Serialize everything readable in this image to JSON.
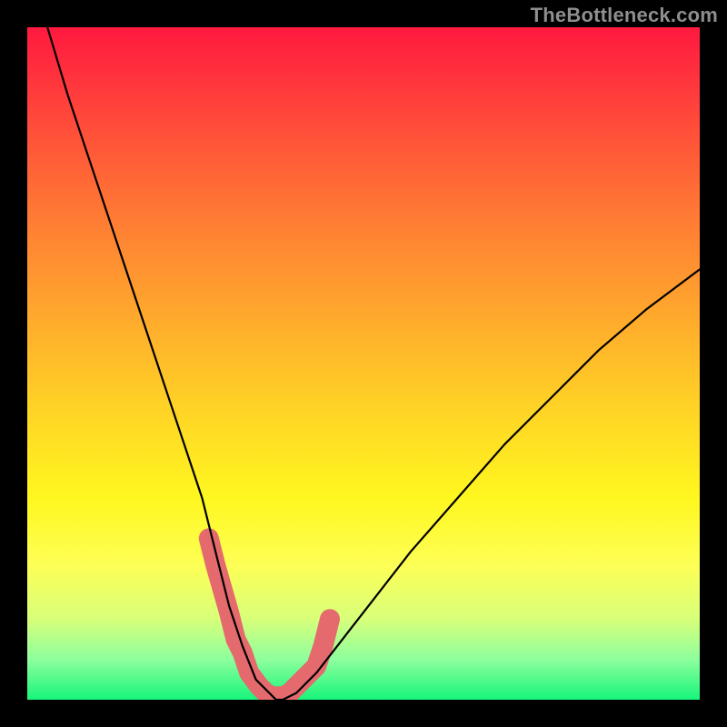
{
  "watermark": "TheBottleneck.com",
  "chart_data": {
    "type": "line",
    "title": "",
    "xlabel": "",
    "ylabel": "",
    "xlim": [
      0,
      100
    ],
    "ylim": [
      0,
      100
    ],
    "grid": false,
    "series": [
      {
        "name": "bottleneck-curve",
        "x": [
          3,
          6,
          10,
          14,
          18,
          22,
          26,
          28,
          30,
          32,
          34,
          36,
          37,
          38,
          40,
          43,
          50,
          57,
          64,
          71,
          78,
          85,
          92,
          100
        ],
        "values": [
          100,
          90,
          78,
          66,
          54,
          42,
          30,
          22,
          14,
          8,
          3,
          1,
          0,
          0,
          1,
          4,
          13,
          22,
          30,
          38,
          45,
          52,
          58,
          64
        ]
      },
      {
        "name": "highlight-band",
        "x": [
          27,
          28,
          30,
          31,
          32,
          33,
          34.5,
          35.5,
          36.5,
          38,
          39,
          40,
          41,
          43,
          44,
          45
        ],
        "values": [
          24,
          20,
          13,
          9,
          7,
          4,
          2,
          1,
          0.5,
          0.5,
          1,
          2,
          3,
          5,
          8,
          12
        ]
      }
    ],
    "annotations": [],
    "legend": false
  }
}
